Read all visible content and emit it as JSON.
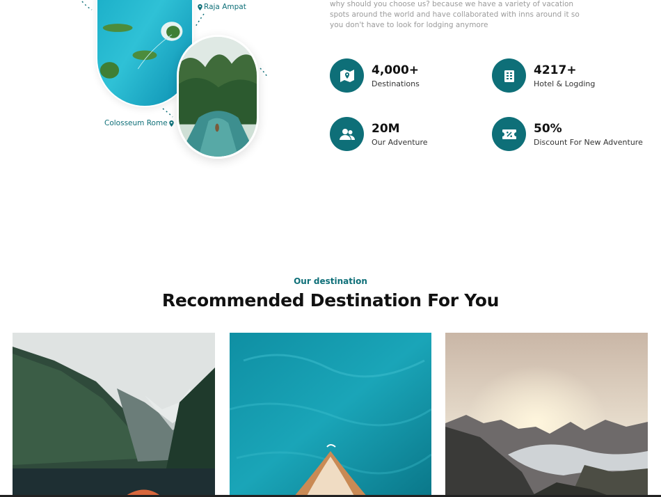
{
  "locations": {
    "raja": "Raja Ampat",
    "rome": "Colosseum Rome"
  },
  "intro_text": "why should you choose us? because we have a variety of vacation spots around the world and have collaborated with inns around it so you don't have to look for lodging anymore",
  "stats": [
    {
      "value": "4,000+",
      "label": "Destinations",
      "icon": "map-icon"
    },
    {
      "value": "4217+",
      "label": "Hotel & Logding",
      "icon": "building-icon"
    },
    {
      "value": "20M",
      "label": "Our Adventure",
      "icon": "users-icon"
    },
    {
      "value": "50%",
      "label": "Discount For New Adventure",
      "icon": "ticket-percent-icon"
    }
  ],
  "section": {
    "kicker": "Our destination",
    "title": "Recommended Destination For You"
  },
  "colors": {
    "accent": "#0e6f78"
  }
}
